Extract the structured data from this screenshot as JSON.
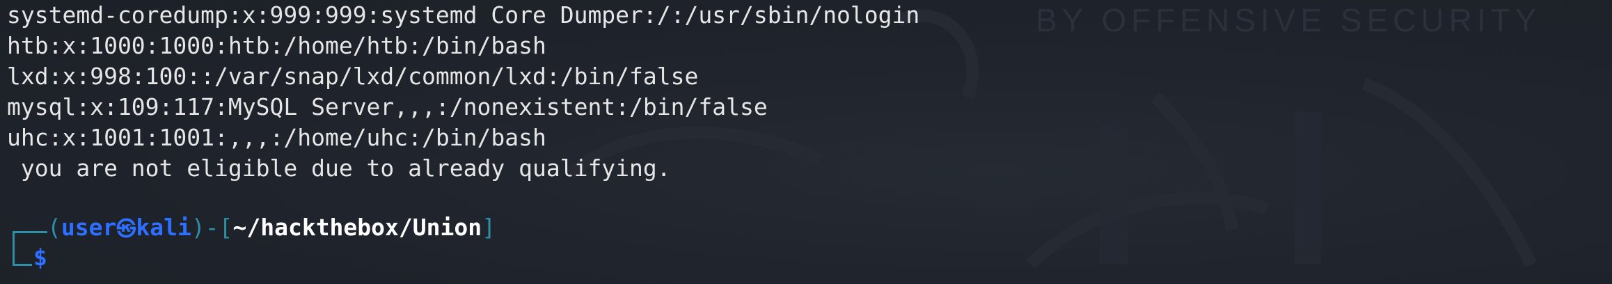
{
  "background_watermark": "BY OFFENSIVE SECURITY",
  "output_lines": [
    "systemd-coredump:x:999:999:systemd Core Dumper:/:/usr/sbin/nologin",
    "htb:x:1000:1000:htb:/home/htb:/bin/bash",
    "lxd:x:998:100::/var/snap/lxd/common/lxd:/bin/false",
    "mysql:x:109:117:MySQL Server,,,:/nonexistent:/bin/false",
    "uhc:x:1001:1001:,,,:/home/uhc:/bin/bash",
    " you are not eligible due to already qualifying."
  ],
  "prompt": {
    "open_paren": "(",
    "user": "user",
    "at_icon": "㉿",
    "host": "kali",
    "close_paren": ")",
    "dash": "-",
    "open_bracket": "[",
    "path": "~/hackthebox/Union",
    "close_bracket": "]",
    "symbol": "$"
  },
  "colors": {
    "background": "#1f232b",
    "text": "#e6e6e6",
    "frame": "#2f8fa6",
    "user_host": "#2e6fff",
    "path": "#ffffff"
  }
}
